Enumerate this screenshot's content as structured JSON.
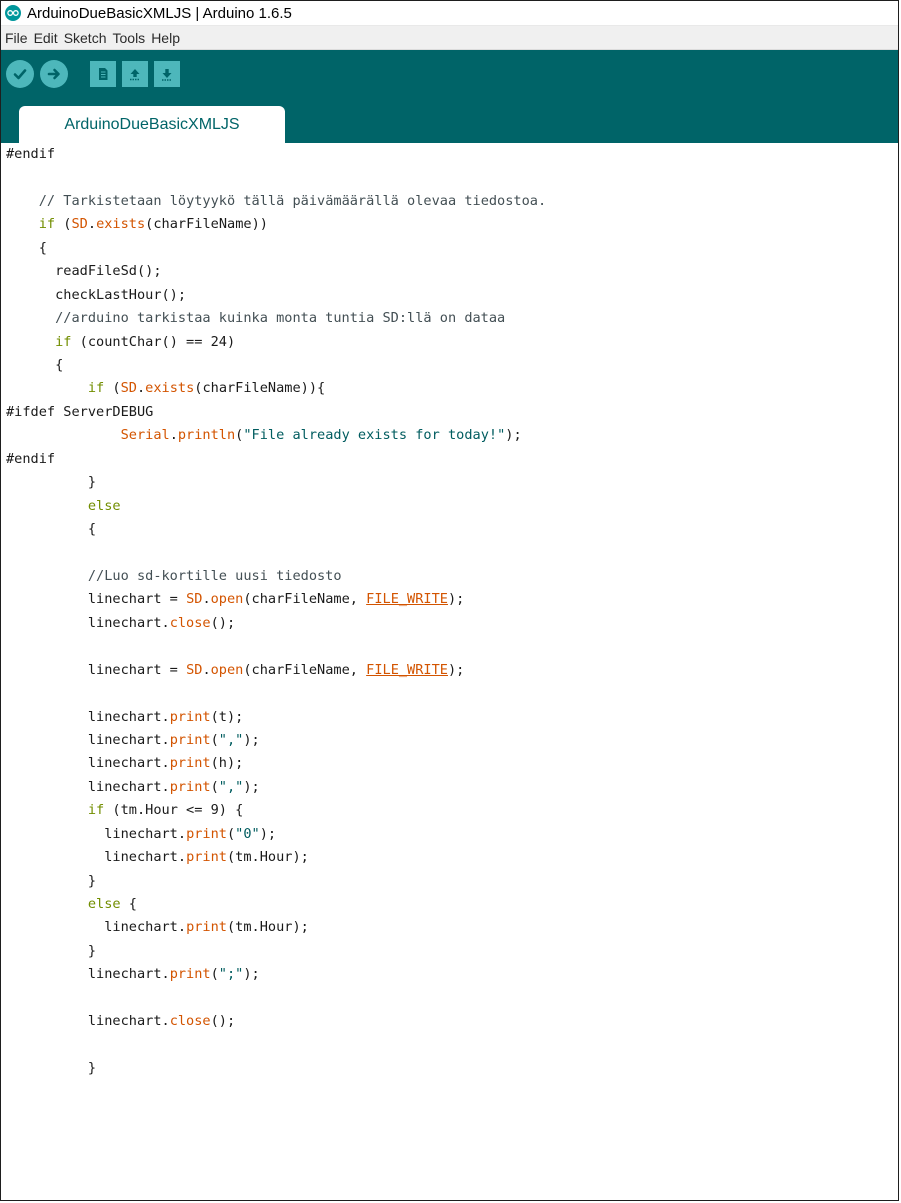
{
  "window": {
    "title": "ArduinoDueBasicXMLJS | Arduino 1.6.5",
    "logo_icon": "arduino-infinity-icon"
  },
  "menu": {
    "items": [
      "File",
      "Edit",
      "Sketch",
      "Tools",
      "Help"
    ]
  },
  "toolbar": {
    "buttons": [
      {
        "name": "verify",
        "icon": "checkmark-icon"
      },
      {
        "name": "upload",
        "icon": "arrow-right-icon"
      },
      {
        "name": "new",
        "icon": "new-file-icon"
      },
      {
        "name": "open",
        "icon": "arrow-up-icon"
      },
      {
        "name": "save",
        "icon": "arrow-down-icon"
      }
    ],
    "colors": {
      "bar": "#006468",
      "button": "#4db7bb"
    }
  },
  "tabs": [
    {
      "label": "ArduinoDueBasicXMLJS",
      "active": true
    }
  ],
  "editor": {
    "lines": [
      [
        [
          "p",
          "#endif"
        ]
      ],
      [
        [
          "p",
          ""
        ]
      ],
      [
        [
          "p",
          "    "
        ],
        [
          "c",
          "// Tarkistetaan löytyykö tällä päivämäärällä olevaa tiedostoa."
        ]
      ],
      [
        [
          "p",
          "    "
        ],
        [
          "k",
          "if"
        ],
        [
          "p",
          " ("
        ],
        [
          "o",
          "SD"
        ],
        [
          "p",
          "."
        ],
        [
          "f",
          "exists"
        ],
        [
          "p",
          "(charFileName))"
        ]
      ],
      [
        [
          "p",
          "    {"
        ]
      ],
      [
        [
          "p",
          "      readFileSd();"
        ]
      ],
      [
        [
          "p",
          "      checkLastHour();"
        ]
      ],
      [
        [
          "p",
          "      "
        ],
        [
          "c",
          "//arduino tarkistaa kuinka monta tuntia SD:llä on dataa"
        ]
      ],
      [
        [
          "p",
          "      "
        ],
        [
          "k",
          "if"
        ],
        [
          "p",
          " (countChar() == 24)"
        ]
      ],
      [
        [
          "p",
          "      {"
        ]
      ],
      [
        [
          "p",
          "          "
        ],
        [
          "k",
          "if"
        ],
        [
          "p",
          " ("
        ],
        [
          "o",
          "SD"
        ],
        [
          "p",
          "."
        ],
        [
          "f",
          "exists"
        ],
        [
          "p",
          "(charFileName)){"
        ]
      ],
      [
        [
          "p",
          "#ifdef ServerDEBUG"
        ]
      ],
      [
        [
          "p",
          "              "
        ],
        [
          "o",
          "Serial"
        ],
        [
          "p",
          "."
        ],
        [
          "f",
          "println"
        ],
        [
          "p",
          "("
        ],
        [
          "s",
          "\"File already exists for today!\""
        ],
        [
          "p",
          ");"
        ]
      ],
      [
        [
          "p",
          "#endif"
        ]
      ],
      [
        [
          "p",
          "          }"
        ]
      ],
      [
        [
          "p",
          "          "
        ],
        [
          "k",
          "else"
        ]
      ],
      [
        [
          "p",
          "          {"
        ]
      ],
      [
        [
          "p",
          ""
        ]
      ],
      [
        [
          "p",
          "          "
        ],
        [
          "c",
          "//Luo sd-kortille uusi tiedosto"
        ]
      ],
      [
        [
          "p",
          "          linechart = "
        ],
        [
          "o",
          "SD"
        ],
        [
          "p",
          "."
        ],
        [
          "f",
          "open"
        ],
        [
          "p",
          "(charFileName, "
        ],
        [
          "u",
          "FILE_WRITE"
        ],
        [
          "p",
          ");"
        ]
      ],
      [
        [
          "p",
          "          linechart."
        ],
        [
          "f",
          "close"
        ],
        [
          "p",
          "();"
        ]
      ],
      [
        [
          "p",
          ""
        ]
      ],
      [
        [
          "p",
          "          linechart = "
        ],
        [
          "o",
          "SD"
        ],
        [
          "p",
          "."
        ],
        [
          "f",
          "open"
        ],
        [
          "p",
          "(charFileName, "
        ],
        [
          "u",
          "FILE_WRITE"
        ],
        [
          "p",
          ");"
        ]
      ],
      [
        [
          "p",
          ""
        ]
      ],
      [
        [
          "p",
          "          linechart."
        ],
        [
          "f",
          "print"
        ],
        [
          "p",
          "(t);"
        ]
      ],
      [
        [
          "p",
          "          linechart."
        ],
        [
          "f",
          "print"
        ],
        [
          "p",
          "("
        ],
        [
          "s",
          "\",\""
        ],
        [
          "p",
          ");"
        ]
      ],
      [
        [
          "p",
          "          linechart."
        ],
        [
          "f",
          "print"
        ],
        [
          "p",
          "(h);"
        ]
      ],
      [
        [
          "p",
          "          linechart."
        ],
        [
          "f",
          "print"
        ],
        [
          "p",
          "("
        ],
        [
          "s",
          "\",\""
        ],
        [
          "p",
          ");"
        ]
      ],
      [
        [
          "p",
          "          "
        ],
        [
          "k",
          "if"
        ],
        [
          "p",
          " (tm.Hour <= 9) {"
        ]
      ],
      [
        [
          "p",
          "            linechart."
        ],
        [
          "f",
          "print"
        ],
        [
          "p",
          "("
        ],
        [
          "s",
          "\"0\""
        ],
        [
          "p",
          ");"
        ]
      ],
      [
        [
          "p",
          "            linechart."
        ],
        [
          "f",
          "print"
        ],
        [
          "p",
          "(tm.Hour);"
        ]
      ],
      [
        [
          "p",
          "          }"
        ]
      ],
      [
        [
          "p",
          "          "
        ],
        [
          "k",
          "else"
        ],
        [
          "p",
          " {"
        ]
      ],
      [
        [
          "p",
          "            linechart."
        ],
        [
          "f",
          "print"
        ],
        [
          "p",
          "(tm.Hour);"
        ]
      ],
      [
        [
          "p",
          "          }"
        ]
      ],
      [
        [
          "p",
          "          linechart."
        ],
        [
          "f",
          "print"
        ],
        [
          "p",
          "("
        ],
        [
          "s",
          "\";\""
        ],
        [
          "p",
          ");"
        ]
      ],
      [
        [
          "p",
          ""
        ]
      ],
      [
        [
          "p",
          "          linechart."
        ],
        [
          "f",
          "close"
        ],
        [
          "p",
          "();"
        ]
      ],
      [
        [
          "p",
          ""
        ]
      ],
      [
        [
          "p",
          "          }"
        ]
      ]
    ]
  }
}
